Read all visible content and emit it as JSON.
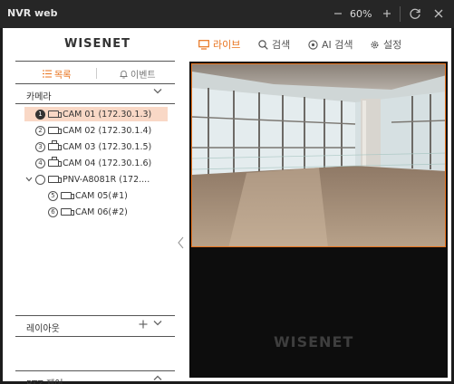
{
  "window": {
    "title": "NVR web",
    "zoom_out_icon": "minus-icon",
    "zoom_level": "60%",
    "zoom_in_icon": "plus-icon",
    "refresh_icon": "refresh-icon",
    "close_icon": "close-icon"
  },
  "header": {
    "logo": "WISENET",
    "nav": [
      {
        "label": "라이브",
        "icon": "monitor-icon",
        "active": true
      },
      {
        "label": "검색",
        "icon": "search-icon"
      },
      {
        "label": "AI 검색",
        "icon": "ai-icon"
      },
      {
        "label": "설정",
        "icon": "gear-icon"
      }
    ],
    "accent_color": "#e8721c"
  },
  "sidebar": {
    "tabs": [
      {
        "label": "목록",
        "icon": "list-icon",
        "active": true
      },
      {
        "label": "이벤트",
        "icon": "bell-icon"
      }
    ],
    "camera_section": {
      "label": "카메라",
      "icon": "chevron-down-icon"
    },
    "tree": [
      {
        "num": "1",
        "label": "CAM 01 (172.30.1.3)",
        "selected": true
      },
      {
        "num": "2",
        "label": "CAM 02 (172.30.1.4)"
      },
      {
        "num": "3",
        "label": "CAM 03 (172.30.1.5)"
      },
      {
        "num": "4",
        "label": "CAM 04 (172.30.1.6)"
      },
      {
        "num": "",
        "label": "PNV-A8081R (172....",
        "group": true
      },
      {
        "num": "5",
        "label": "CAM 05(#1)"
      },
      {
        "num": "6",
        "label": "CAM 06(#2)"
      }
    ],
    "layout_section": {
      "label": "레이아웃",
      "add_icon": "plus-icon",
      "icon": "chevron-down-icon"
    },
    "ptz_section": {
      "label": "PTZ 제어",
      "icon": "chevron-up-icon"
    }
  },
  "video": {
    "tile_1": {
      "content": "camera-feed"
    },
    "tile_2": {
      "watermark": "WISENET"
    }
  }
}
